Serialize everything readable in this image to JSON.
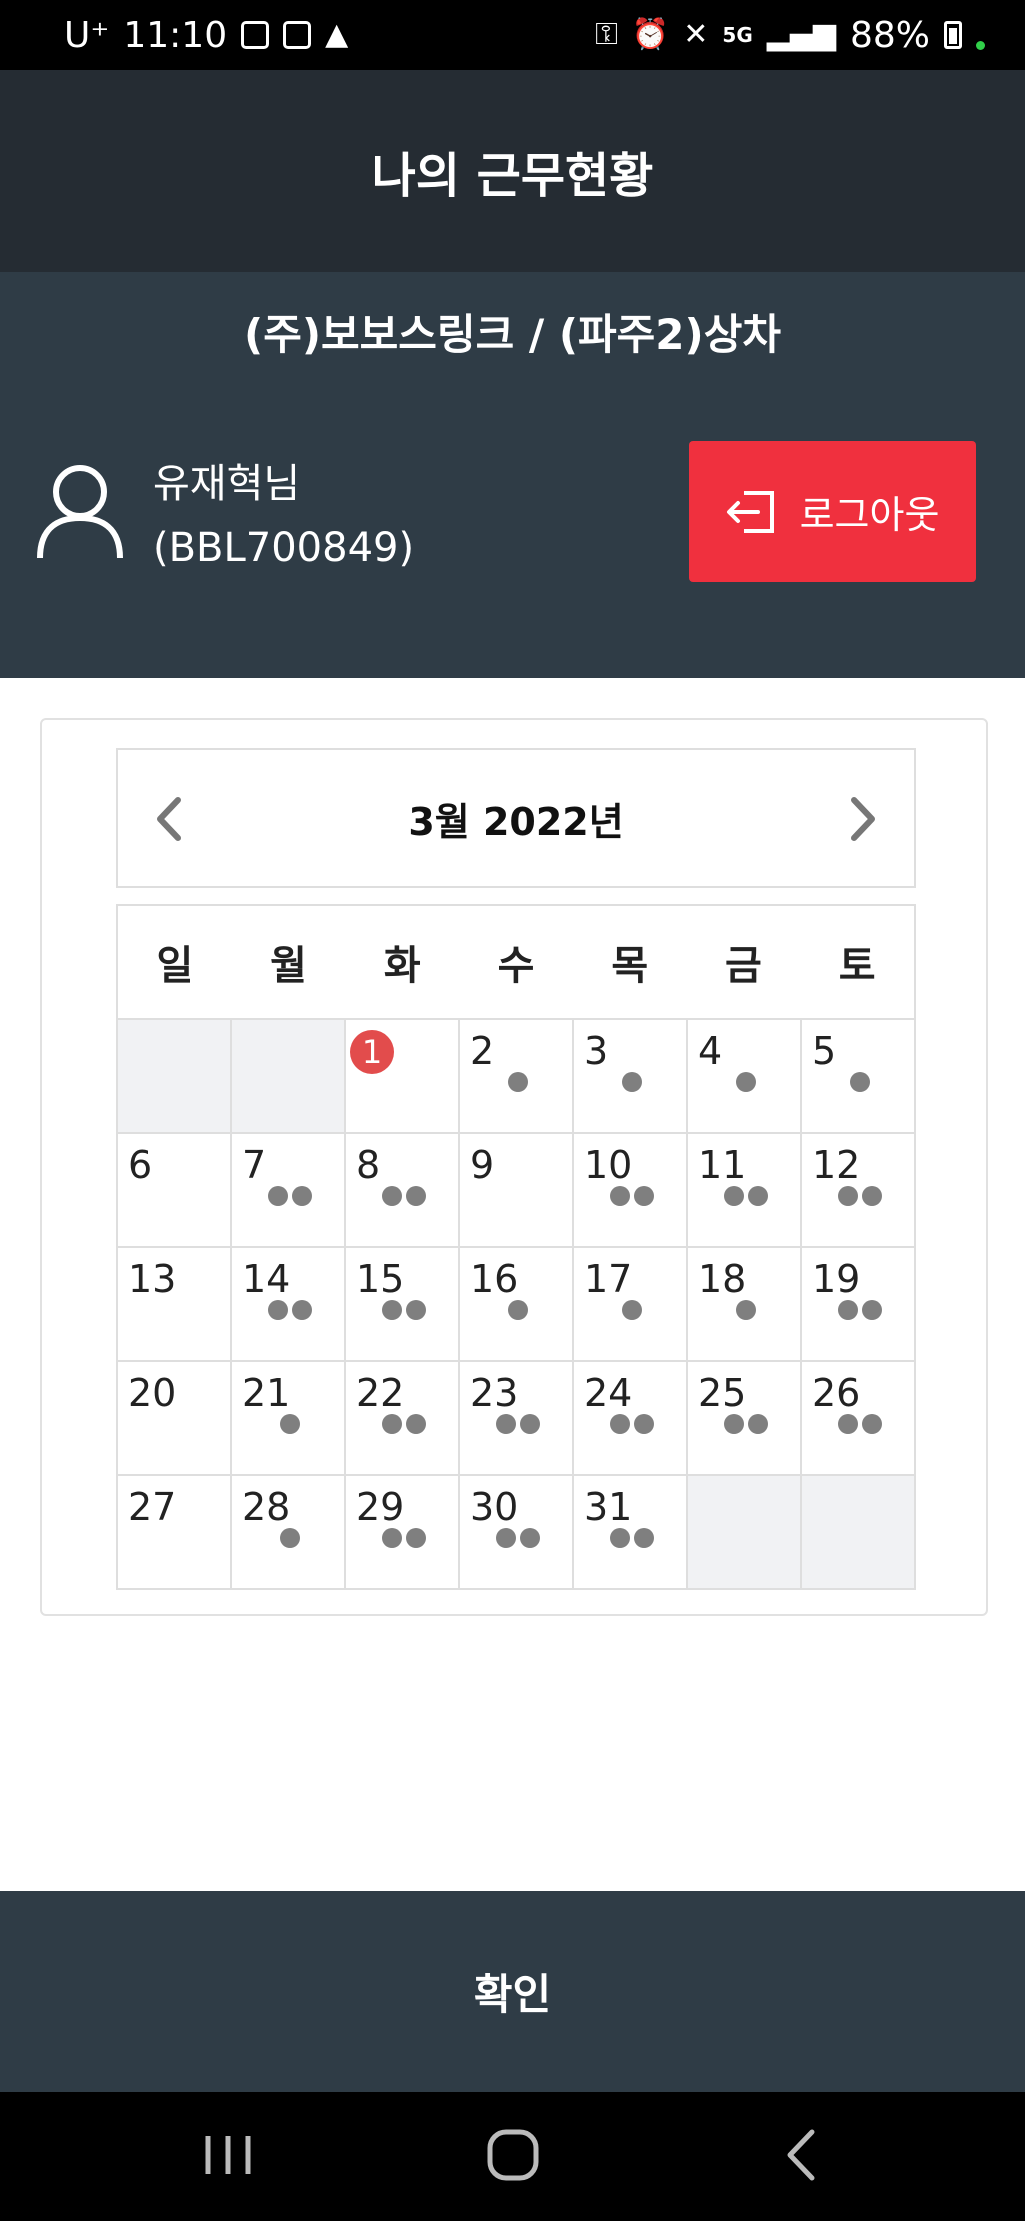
{
  "status_bar": {
    "carrier": "U⁺",
    "time": "11:10",
    "network": "5G",
    "battery": "88%"
  },
  "header": {
    "title": "나의 근무현황"
  },
  "company": {
    "name": "(주)보보스링크 / (파주2)상차"
  },
  "user": {
    "name": "유재혁님",
    "id": "(BBL700849)"
  },
  "logout": {
    "label": "로그아웃"
  },
  "calendar": {
    "month_label": "3월 2022년",
    "weekdays": [
      "일",
      "월",
      "화",
      "수",
      "목",
      "금",
      "토"
    ],
    "today": "1",
    "weeks": [
      [
        {
          "d": "",
          "n": 0
        },
        {
          "d": "",
          "n": 0
        },
        {
          "d": "1",
          "n": 0
        },
        {
          "d": "2",
          "n": 1
        },
        {
          "d": "3",
          "n": 1
        },
        {
          "d": "4",
          "n": 1
        },
        {
          "d": "5",
          "n": 1
        }
      ],
      [
        {
          "d": "6",
          "n": 0
        },
        {
          "d": "7",
          "n": 2
        },
        {
          "d": "8",
          "n": 2
        },
        {
          "d": "9",
          "n": 0
        },
        {
          "d": "10",
          "n": 2
        },
        {
          "d": "11",
          "n": 2
        },
        {
          "d": "12",
          "n": 2
        }
      ],
      [
        {
          "d": "13",
          "n": 0
        },
        {
          "d": "14",
          "n": 2
        },
        {
          "d": "15",
          "n": 2
        },
        {
          "d": "16",
          "n": 1
        },
        {
          "d": "17",
          "n": 1
        },
        {
          "d": "18",
          "n": 1
        },
        {
          "d": "19",
          "n": 2
        }
      ],
      [
        {
          "d": "20",
          "n": 0
        },
        {
          "d": "21",
          "n": 1
        },
        {
          "d": "22",
          "n": 2
        },
        {
          "d": "23",
          "n": 2
        },
        {
          "d": "24",
          "n": 2
        },
        {
          "d": "25",
          "n": 2
        },
        {
          "d": "26",
          "n": 2
        }
      ],
      [
        {
          "d": "27",
          "n": 0
        },
        {
          "d": "28",
          "n": 1
        },
        {
          "d": "29",
          "n": 2
        },
        {
          "d": "30",
          "n": 2
        },
        {
          "d": "31",
          "n": 2
        },
        {
          "d": "",
          "n": 0
        },
        {
          "d": "",
          "n": 0
        }
      ]
    ]
  },
  "footer": {
    "confirm_label": "확인"
  },
  "colors": {
    "header_bg": "#252c33",
    "panel_bg": "#2f3c46",
    "logout_bg": "#f0303e",
    "today_badge": "#e24c4c",
    "dot": "#7f7f7f"
  }
}
